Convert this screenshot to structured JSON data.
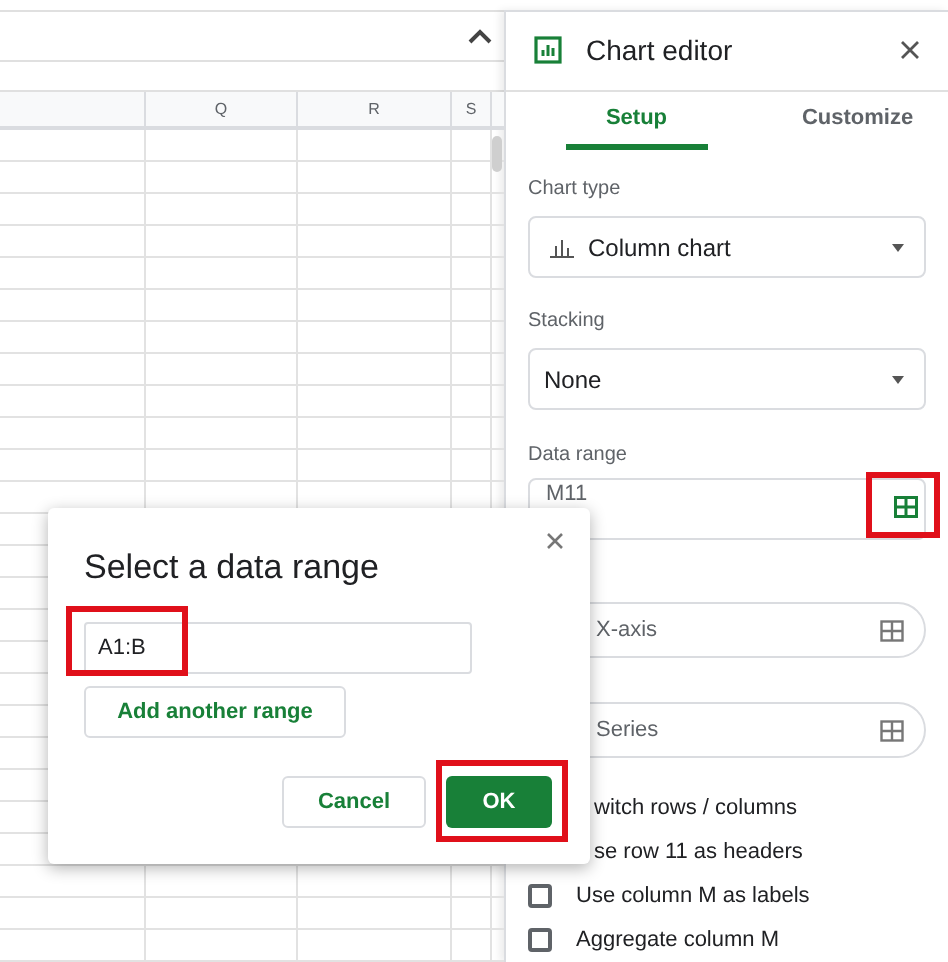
{
  "sheet": {
    "columns": [
      "",
      "Q",
      "R",
      "S"
    ]
  },
  "chart_editor": {
    "title": "Chart editor",
    "tabs": [
      {
        "label": "Setup",
        "selected": true
      },
      {
        "label": "Customize",
        "selected": false
      }
    ],
    "chart_type": {
      "label": "Chart type",
      "value": "Column chart"
    },
    "stacking": {
      "label": "Stacking",
      "value": "None"
    },
    "data_range": {
      "label": "Data range",
      "value": "M11"
    },
    "range_pills": [
      "X-axis",
      "Series"
    ],
    "covered_options": [
      "witch rows / columns",
      "se row 11 as headers"
    ],
    "checkboxes": [
      {
        "label": "Use column M as labels",
        "checked": false
      },
      {
        "label": "Aggregate column M",
        "checked": false
      }
    ]
  },
  "dialog": {
    "title": "Select a data range",
    "range_value": "A1:B",
    "add_button": "Add another range",
    "cancel_button": "Cancel",
    "ok_button": "OK"
  }
}
